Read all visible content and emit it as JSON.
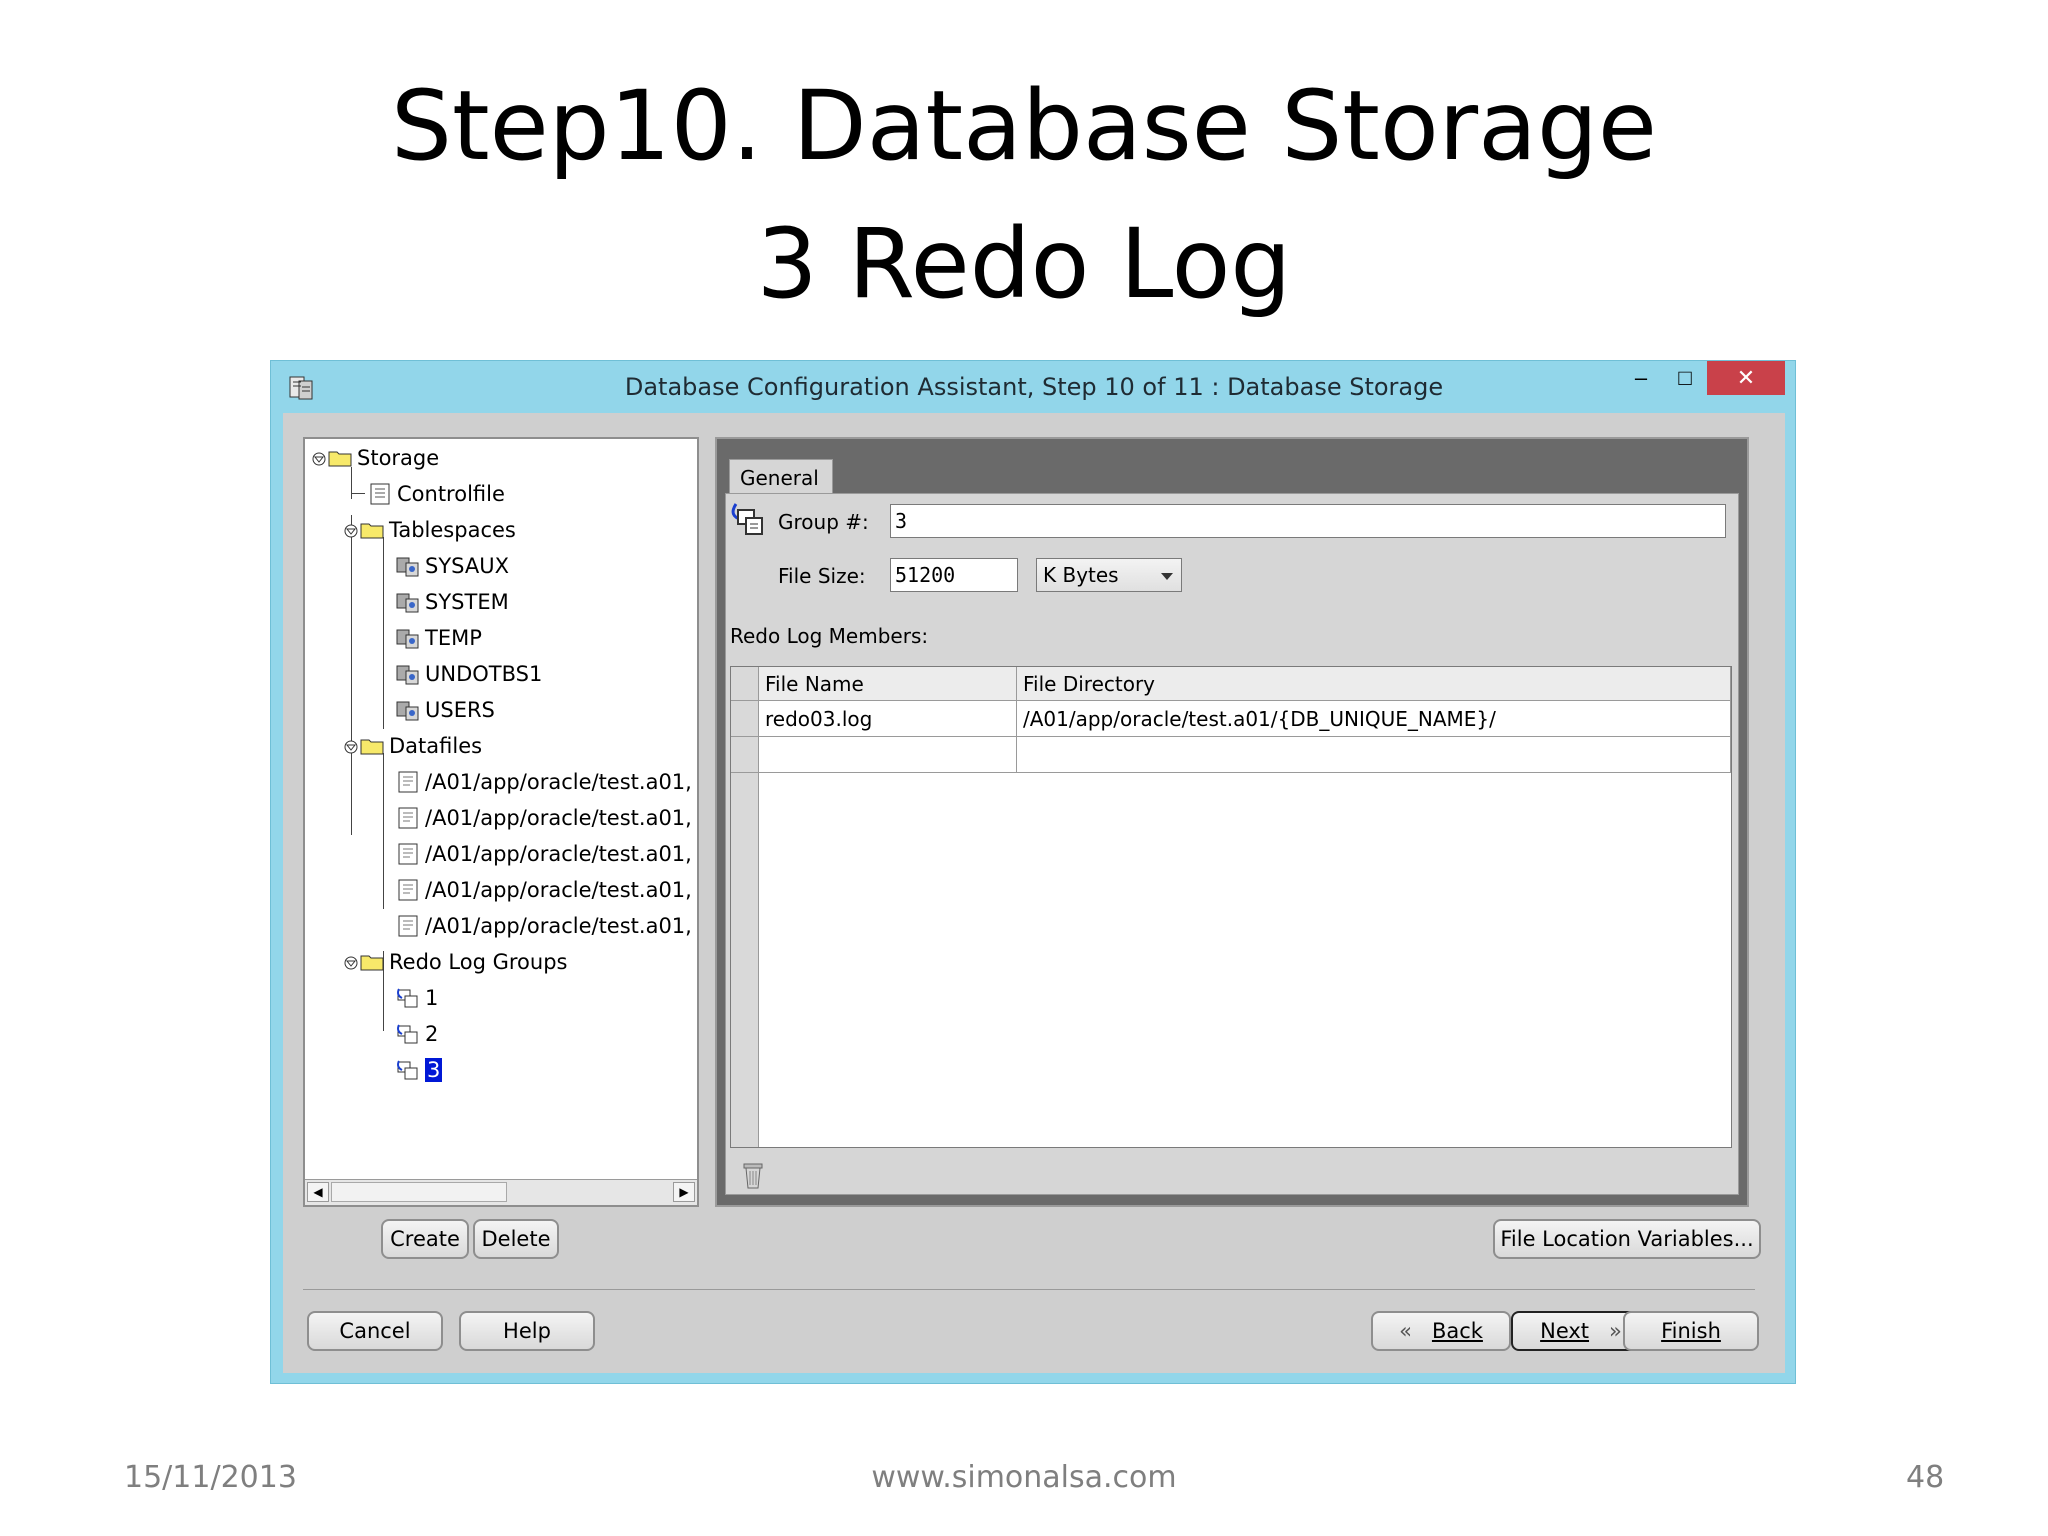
{
  "slide": {
    "title_line1": "Step10. Database Storage",
    "title_line2": "3 Redo Log",
    "footer_date": "15/11/2013",
    "footer_site": "www.simonalsa.com",
    "footer_page": "48"
  },
  "window": {
    "title": "Database Configuration Assistant, Step 10 of 11 : Database Storage",
    "minimize": "–",
    "maximize": "□",
    "close": "✕"
  },
  "tree": {
    "storage": "Storage",
    "controlfile": "Controlfile",
    "tablespaces": "Tablespaces",
    "tablespace_items": [
      "SYSAUX",
      "SYSTEM",
      "TEMP",
      "UNDOTBS1",
      "USERS"
    ],
    "datafiles": "Datafiles",
    "datafile_items": [
      "/A01/app/oracle/test.a01,",
      "/A01/app/oracle/test.a01,",
      "/A01/app/oracle/test.a01,",
      "/A01/app/oracle/test.a01,",
      "/A01/app/oracle/test.a01,"
    ],
    "redo_groups": "Redo Log Groups",
    "redo_group_items": [
      "1",
      "2",
      "3"
    ]
  },
  "tree_buttons": {
    "create": "Create",
    "delete": "Delete"
  },
  "general": {
    "tab": "General",
    "group_label": "Group #:",
    "group_value": "3",
    "filesize_label": "File Size:",
    "filesize_value": "51200",
    "unit_value": "K Bytes",
    "members_label": "Redo Log Members:",
    "columns": [
      "File Name",
      "File Directory"
    ],
    "rows": [
      [
        "redo03.log",
        "/A01/app/oracle/test.a01/{DB_UNIQUE_NAME}/"
      ],
      [
        "",
        ""
      ]
    ]
  },
  "file_location_button": "File Location Variables...",
  "nav": {
    "cancel": "Cancel",
    "help": "Help",
    "back": "Back",
    "next": "Next",
    "finish": "Finish"
  }
}
